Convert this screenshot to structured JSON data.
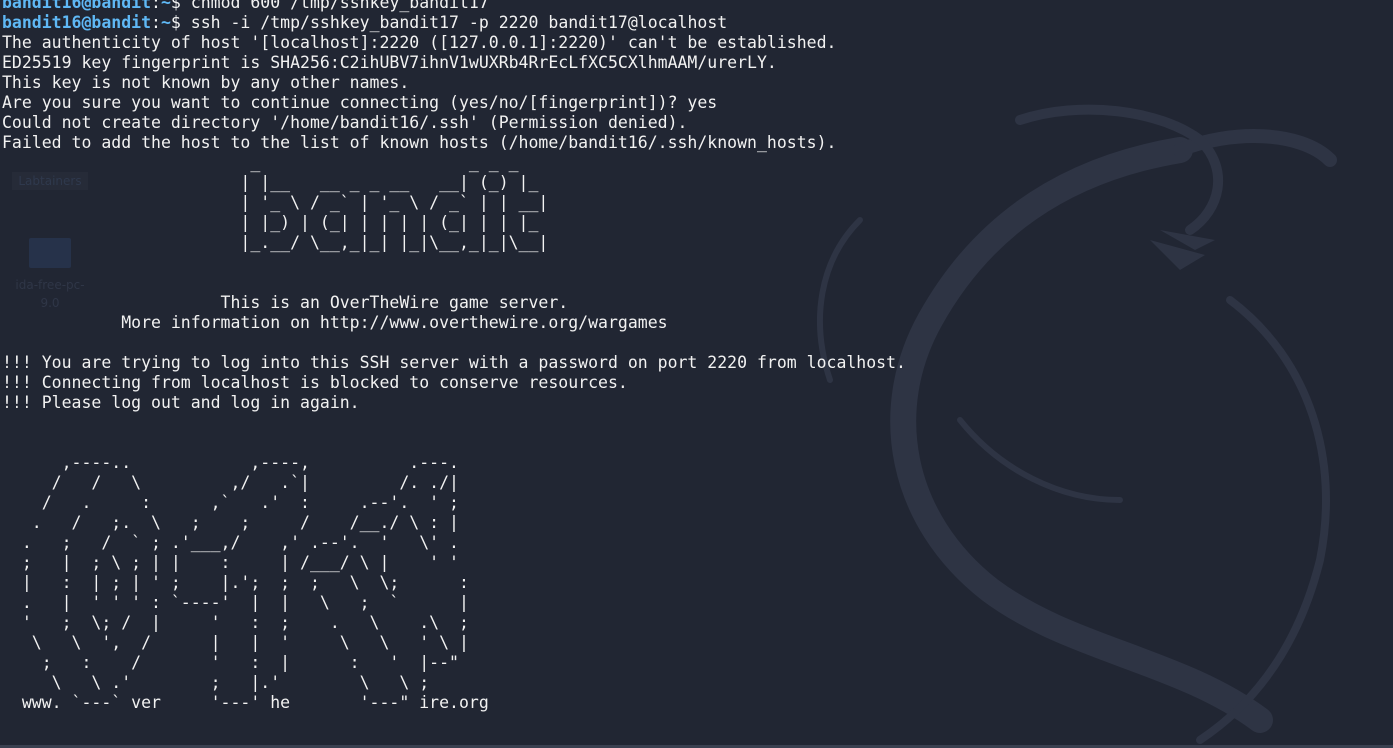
{
  "prompt": {
    "user_host": "bandit16@bandit",
    "separator": ":",
    "path": "~",
    "symbol": "$ "
  },
  "desktop_icons": [
    {
      "label": "Labtainers",
      "icon": "folder-icon"
    },
    {
      "label": "ida-free-pc-",
      "label2": "9.0",
      "icon": "app-icon"
    }
  ],
  "lines": [
    {
      "type": "cmd",
      "text": "chmod 600 /tmp/sshkey_bandit17"
    },
    {
      "type": "cmd",
      "text": "ssh -i /tmp/sshkey_bandit17 -p 2220 bandit17@localhost"
    },
    {
      "type": "out",
      "text": "The authenticity of host '[localhost]:2220 ([127.0.0.1]:2220)' can't be established."
    },
    {
      "type": "out",
      "text": "ED25519 key fingerprint is SHA256:C2ihUBV7ihnV1wUXRb4RrEcLfXC5CXlhmAAM/urerLY."
    },
    {
      "type": "out",
      "text": "This key is not known by any other names."
    },
    {
      "type": "out",
      "text": "Are you sure you want to continue connecting (yes/no/[fingerprint])? yes"
    },
    {
      "type": "out",
      "text": "Could not create directory '/home/bandit16/.ssh' (Permission denied)."
    },
    {
      "type": "out",
      "text": "Failed to add the host to the list of known hosts (/home/bandit16/.ssh/known_hosts)."
    },
    {
      "type": "out",
      "text": "                         _                     _ _ _"
    },
    {
      "type": "out",
      "text": "                        | |__   __ _ _ __   __| (_) |_"
    },
    {
      "type": "out",
      "text": "                        | '_ \\ / _` | '_ \\ / _` | | __|"
    },
    {
      "type": "out",
      "text": "                        | |_) | (_| | | | | (_| | | |_"
    },
    {
      "type": "out",
      "text": "                        |_.__/ \\__,_|_| |_|\\__,_|_|\\__|"
    },
    {
      "type": "out",
      "text": ""
    },
    {
      "type": "out",
      "text": ""
    },
    {
      "type": "out",
      "text": "                      This is an OverTheWire game server."
    },
    {
      "type": "out",
      "text": "            More information on http://www.overthewire.org/wargames"
    },
    {
      "type": "out",
      "text": ""
    },
    {
      "type": "out",
      "text": "!!! You are trying to log into this SSH server with a password on port 2220 from localhost."
    },
    {
      "type": "out",
      "text": "!!! Connecting from localhost is blocked to conserve resources."
    },
    {
      "type": "out",
      "text": "!!! Please log out and log in again."
    },
    {
      "type": "out",
      "text": ""
    },
    {
      "type": "out",
      "text": ""
    },
    {
      "type": "out",
      "text": "      ,----..            ,----,          .---."
    },
    {
      "type": "out",
      "text": "     /   /   \\         ,/   .`|         /. ./|"
    },
    {
      "type": "out",
      "text": "    /   .     :      ,`   .'  :     .--'.  ' ;"
    },
    {
      "type": "out",
      "text": "   .   /   ;.  \\   ;    ;     /    /__./ \\ : |"
    },
    {
      "type": "out",
      "text": "  .   ;   /  ` ; .'___,/    ,' .--'.  '   \\' ."
    },
    {
      "type": "out",
      "text": "  ;   |  ; \\ ; | |    :     | /___/ \\ |    ' '"
    },
    {
      "type": "out",
      "text": "  |   :  | ; | ' ;    |.';  ;  ;   \\  \\;      :"
    },
    {
      "type": "out",
      "text": "  .   |  ' ' ' : `----'  |  |   \\   ;  `      |"
    },
    {
      "type": "out",
      "text": "  '   ;  \\; /  |     '   :  ;    .   \\    .\\  ;"
    },
    {
      "type": "out",
      "text": "   \\   \\  ',  /      |   |  '     \\   \\   ' \\ |"
    },
    {
      "type": "out",
      "text": "    ;   :    /       '   :  |      :   '  |--\""
    },
    {
      "type": "out",
      "text": "     \\   \\ .'        ;   |.'        \\   \\ ;"
    },
    {
      "type": "out",
      "text": "  www. `---` ver     '---' he       '---\" ire.org"
    }
  ]
}
